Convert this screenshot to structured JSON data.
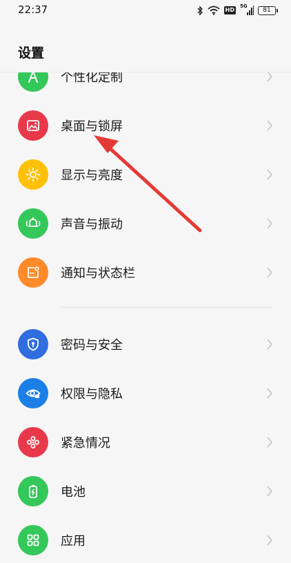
{
  "status": {
    "time": "22:37",
    "network_badge": "HD",
    "signal_label": "5G",
    "battery_level": "81"
  },
  "page": {
    "title": "设置"
  },
  "items": [
    {
      "label": "个性化定制",
      "icon": "palette-icon",
      "color": "#34c759"
    },
    {
      "label": "桌面与锁屏",
      "icon": "image-icon",
      "color": "#e8394a"
    },
    {
      "label": "显示与亮度",
      "icon": "sun-icon",
      "color": "#ffc107"
    },
    {
      "label": "声音与振动",
      "icon": "bell-icon",
      "color": "#34c759"
    },
    {
      "label": "通知与状态栏",
      "icon": "notification-icon",
      "color": "#ff8a2a"
    },
    {
      "label": "密码与安全",
      "icon": "shield-lock-icon",
      "color": "#2f6de1"
    },
    {
      "label": "权限与隐私",
      "icon": "eye-lock-icon",
      "color": "#1c7fe6"
    },
    {
      "label": "紧急情况",
      "icon": "emergency-icon",
      "color": "#e8394a"
    },
    {
      "label": "电池",
      "icon": "battery-icon",
      "color": "#34c759"
    },
    {
      "label": "应用",
      "icon": "apps-grid-icon",
      "color": "#34c759"
    }
  ],
  "annotation": {
    "color": "#e53935"
  }
}
